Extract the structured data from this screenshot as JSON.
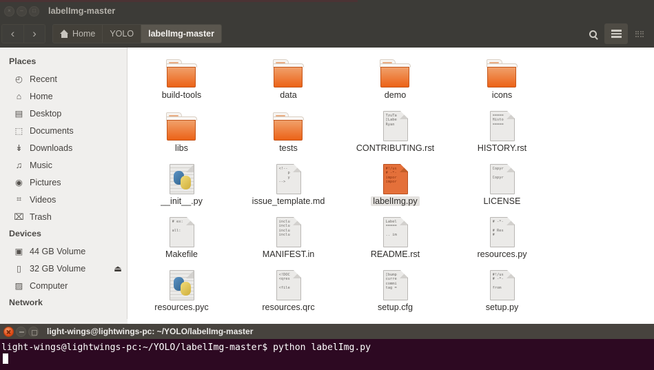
{
  "window": {
    "title": "labelImg-master",
    "buttons": [
      {
        "name": "close",
        "glyph": "×"
      },
      {
        "name": "minimize",
        "glyph": "–"
      },
      {
        "name": "maximize",
        "glyph": "□"
      }
    ]
  },
  "toolbar": {
    "back_label": "‹",
    "forward_label": "›",
    "breadcrumbs": [
      {
        "label": "Home",
        "icon": "home-icon",
        "active": false
      },
      {
        "label": "YOLO",
        "icon": "",
        "active": false
      },
      {
        "label": "labelImg-master",
        "icon": "",
        "active": true
      }
    ],
    "actions": [
      {
        "name": "search-icon",
        "label": "Search",
        "active": false
      },
      {
        "name": "list-view-icon",
        "label": "List view",
        "active": true
      },
      {
        "name": "grid-view-icon",
        "label": "Icon view",
        "active": false
      }
    ]
  },
  "sidebar": {
    "sections": [
      {
        "heading": "Places",
        "items": [
          {
            "label": "Recent",
            "icon": "clock-icon",
            "glyph": "◴"
          },
          {
            "label": "Home",
            "icon": "home-icon",
            "glyph": "⌂"
          },
          {
            "label": "Desktop",
            "icon": "desktop-icon",
            "glyph": "▤"
          },
          {
            "label": "Documents",
            "icon": "document-icon",
            "glyph": "⬚"
          },
          {
            "label": "Downloads",
            "icon": "download-icon",
            "glyph": "↡"
          },
          {
            "label": "Music",
            "icon": "music-icon",
            "glyph": "♫"
          },
          {
            "label": "Pictures",
            "icon": "camera-icon",
            "glyph": "◉"
          },
          {
            "label": "Videos",
            "icon": "film-icon",
            "glyph": "⌗"
          },
          {
            "label": "Trash",
            "icon": "trash-icon",
            "glyph": "⌧"
          }
        ]
      },
      {
        "heading": "Devices",
        "items": [
          {
            "label": "44 GB Volume",
            "icon": "drive-icon",
            "glyph": "▣"
          },
          {
            "label": "32 GB Volume",
            "icon": "usb-drive-icon",
            "glyph": "▯",
            "eject": "⏏"
          },
          {
            "label": "Computer",
            "icon": "computer-icon",
            "glyph": "▨"
          }
        ]
      },
      {
        "heading": "Network",
        "items": []
      }
    ]
  },
  "files": [
    {
      "name": "build-tools",
      "type": "folder",
      "selected": false,
      "preview": ""
    },
    {
      "name": "data",
      "type": "folder",
      "selected": false,
      "preview": ""
    },
    {
      "name": "demo",
      "type": "folder",
      "selected": false,
      "preview": ""
    },
    {
      "name": "icons",
      "type": "folder",
      "selected": false,
      "preview": ""
    },
    {
      "name": "libs",
      "type": "folder",
      "selected": false,
      "preview": ""
    },
    {
      "name": "tests",
      "type": "folder",
      "selected": false,
      "preview": ""
    },
    {
      "name": "CONTRIBUTING.rst",
      "type": "document",
      "selected": false,
      "preview": "TzuTa\n[Labe\nRyan"
    },
    {
      "name": "HISTORY.rst",
      "type": "document",
      "selected": false,
      "preview": "=====\nHisto\n====="
    },
    {
      "name": "__init__.py",
      "type": "python",
      "selected": false,
      "preview": ""
    },
    {
      "name": "issue_template.md",
      "type": "document",
      "selected": false,
      "preview": "<!--\n    p\n    y\n-->"
    },
    {
      "name": "labelImg.py",
      "type": "executable",
      "selected": true,
      "preview": "#!/us\n# -*-\nimpor\nimpor"
    },
    {
      "name": "LICENSE",
      "type": "document",
      "selected": false,
      "preview": "Copyr\n\nCopyr"
    },
    {
      "name": "Makefile",
      "type": "document",
      "selected": false,
      "preview": "# ex:\n\nall:"
    },
    {
      "name": "MANIFEST.in",
      "type": "document",
      "selected": false,
      "preview": "inclu\ninclu\ninclu\ninclu"
    },
    {
      "name": "README.rst",
      "type": "document",
      "selected": false,
      "preview": "Label\n=====\n\n.. im"
    },
    {
      "name": "resources.py",
      "type": "document",
      "selected": false,
      "preview": "# -*-\n\n# Res\n#"
    },
    {
      "name": "resources.pyc",
      "type": "python",
      "selected": false,
      "preview": ""
    },
    {
      "name": "resources.qrc",
      "type": "document",
      "selected": false,
      "preview": "<!DOC\n<qres\n\n<file"
    },
    {
      "name": "setup.cfg",
      "type": "document",
      "selected": false,
      "preview": "[bump\ncurre\ncommi\ntag ="
    },
    {
      "name": "setup.py",
      "type": "document",
      "selected": false,
      "preview": "#!/us\n# -*-\n\nfrom"
    }
  ],
  "terminal": {
    "title": "light-wings@lightwings-pc: ~/YOLO/labelImg-master",
    "lines": [
      "light-wings@lightwings-pc:~/YOLO/labelImg-master$ python labelImg.py"
    ]
  }
}
